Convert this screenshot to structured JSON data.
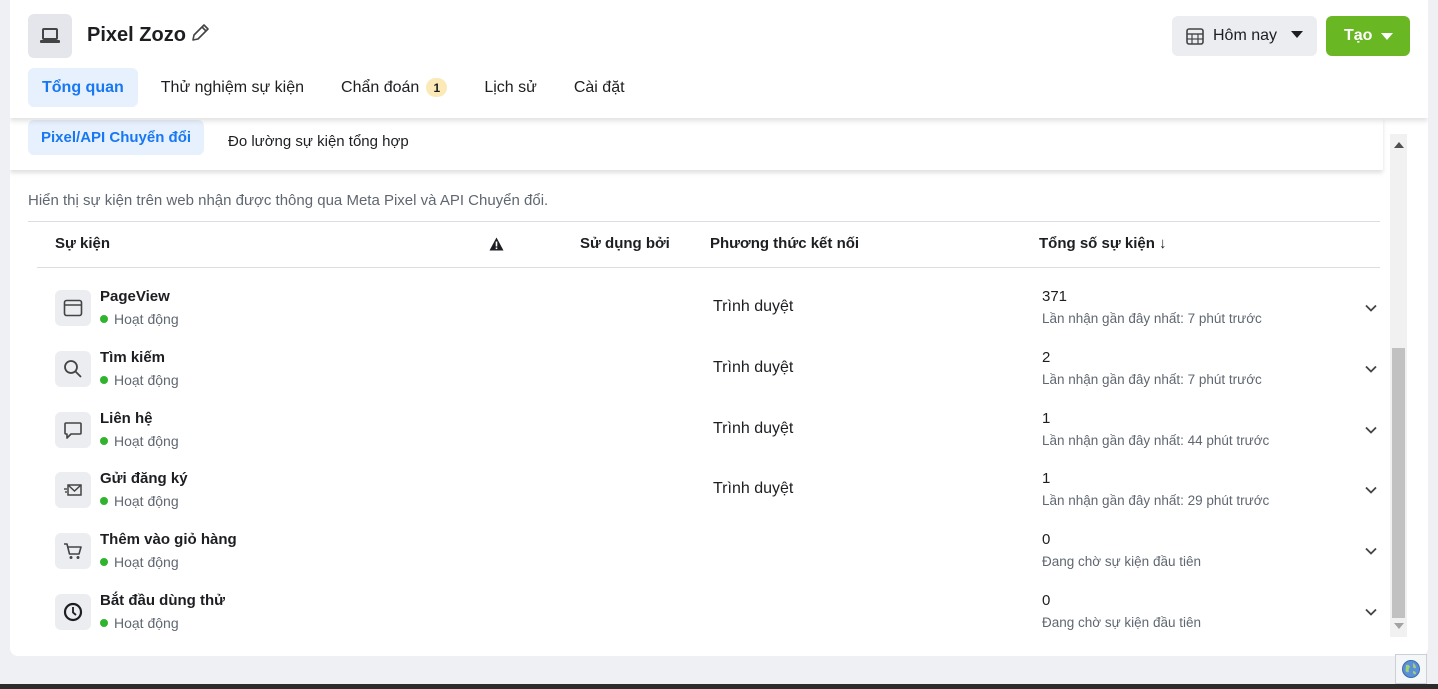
{
  "header": {
    "title": "Pixel Zozo",
    "date_button_label": "Hôm nay",
    "create_button_label": "Tạo"
  },
  "tabs": [
    {
      "label": "Tổng quan",
      "active": true
    },
    {
      "label": "Thử nghiệm sự kiện"
    },
    {
      "label": "Chẩn đoán",
      "badge": "1"
    },
    {
      "label": "Lịch sử"
    },
    {
      "label": "Cài đặt"
    }
  ],
  "subtabs": [
    {
      "label": "Pixel/API Chuyển đổi",
      "active": true
    },
    {
      "label": "Đo lường sự kiện tổng hợp"
    }
  ],
  "description": "Hiển thị sự kiện trên web nhận được thông qua Meta Pixel và API Chuyển đổi.",
  "table": {
    "headers": {
      "event": "Sự kiện",
      "used_by": "Sử dụng bởi",
      "connection_method": "Phương thức kết nối",
      "total_events": "Tổng số sự kiện ↓"
    },
    "rows": [
      {
        "name": "PageView",
        "status": "Hoạt động",
        "icon": "browser-icon",
        "method": "Trình duyệt",
        "count": "371",
        "last": "Lần nhận gần đây nhất: 7 phút trước"
      },
      {
        "name": "Tìm kiếm",
        "status": "Hoạt động",
        "icon": "search-icon",
        "method": "Trình duyệt",
        "count": "2",
        "last": "Lần nhận gần đây nhất: 7 phút trước"
      },
      {
        "name": "Liên hệ",
        "status": "Hoạt động",
        "icon": "chat-bubble-icon",
        "method": "Trình duyệt",
        "count": "1",
        "last": "Lần nhận gần đây nhất: 44 phút trước"
      },
      {
        "name": "Gửi đăng ký",
        "status": "Hoạt động",
        "icon": "send-mail-icon",
        "method": "Trình duyệt",
        "count": "1",
        "last": "Lần nhận gần đây nhất: 29 phút trước"
      },
      {
        "name": "Thêm vào giỏ hàng",
        "status": "Hoạt động",
        "icon": "cart-icon",
        "method": "",
        "count": "0",
        "last": "Đang chờ sự kiện đầu tiên"
      },
      {
        "name": "Bắt đầu dùng thử",
        "status": "Hoạt động",
        "icon": "clock-icon",
        "method": "",
        "count": "0",
        "last": "Đang chờ sự kiện đầu tiên"
      }
    ]
  },
  "colors": {
    "accent": "#1877f2",
    "create_green": "#69b722",
    "active_dot": "#32b32f"
  }
}
